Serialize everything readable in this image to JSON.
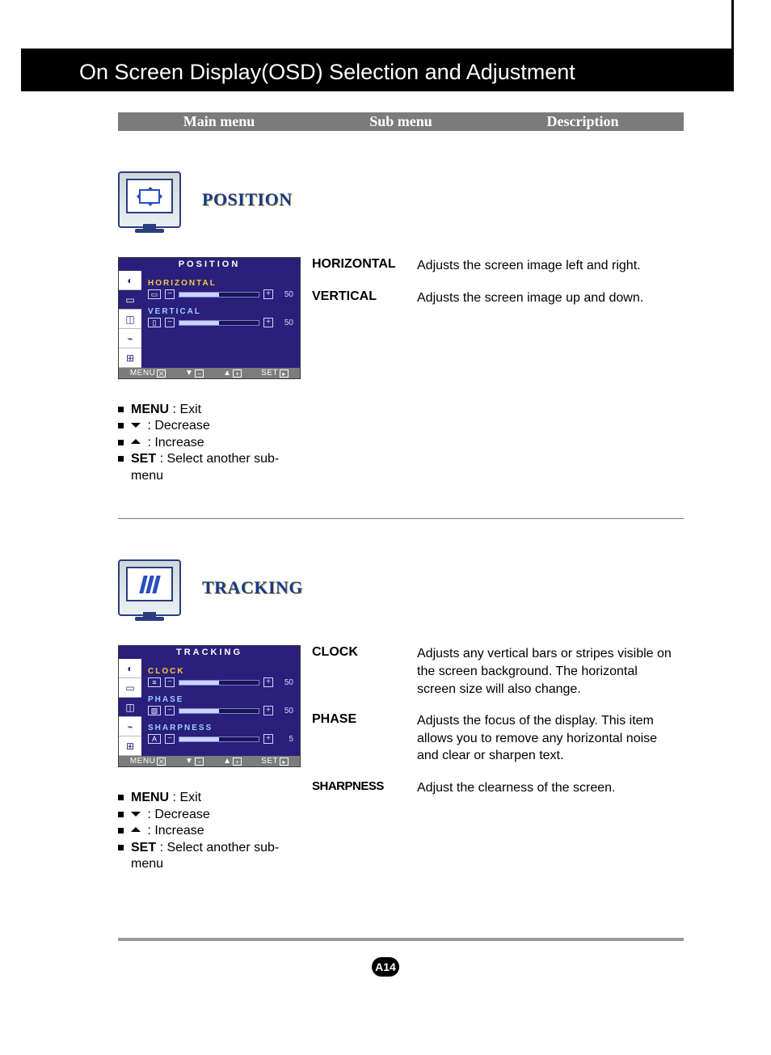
{
  "page_title": "On Screen Display(OSD) Selection and Adjustment",
  "columns": {
    "main": "Main menu",
    "sub": "Sub menu",
    "desc": "Description"
  },
  "sections": [
    {
      "id": "position",
      "title": "POSITION",
      "osd": {
        "title": "POSITION",
        "rows": [
          {
            "label": "HORIZONTAL",
            "value": "50",
            "selected": true
          },
          {
            "label": "VERTICAL",
            "value": "50",
            "selected": false
          }
        ],
        "footer": {
          "menu": "MENU",
          "down": "▼",
          "up": "▲",
          "set": "SET"
        }
      },
      "defs": [
        {
          "term": "HORIZONTAL",
          "desc": "Adjusts the screen image left and right."
        },
        {
          "term": "VERTICAL",
          "desc": "Adjusts the screen image up and down."
        }
      ],
      "bullets": [
        {
          "strong": "MENU",
          "rest": " : Exit"
        },
        {
          "glyph": "down",
          "rest": " : Decrease"
        },
        {
          "glyph": "up",
          "rest": " : Increase"
        },
        {
          "strong": "SET",
          "rest": " : Select another sub-menu"
        }
      ]
    },
    {
      "id": "tracking",
      "title": "TRACKING",
      "osd": {
        "title": "TRACKING",
        "rows": [
          {
            "label": "CLOCK",
            "value": "50",
            "selected": true
          },
          {
            "label": "PHASE",
            "value": "50",
            "selected": false
          },
          {
            "label": "SHARPNESS",
            "value": "5",
            "selected": false,
            "iconText": "A"
          }
        ],
        "footer": {
          "menu": "MENU",
          "down": "▼",
          "up": "▲",
          "set": "SET"
        }
      },
      "defs": [
        {
          "term": "CLOCK",
          "desc": "Adjusts any vertical bars or stripes visible on the screen background. The horizontal screen size will also change."
        },
        {
          "term": "PHASE",
          "desc": "Adjusts the focus of the display. This item allows you to remove any horizontal noise and clear or sharpen text."
        },
        {
          "term": "SHARPNESS",
          "desc": "Adjust the clearness of the screen.",
          "narrow": true
        }
      ],
      "bullets": [
        {
          "strong": "MENU",
          "rest": " : Exit"
        },
        {
          "glyph": "down",
          "rest": " : Decrease"
        },
        {
          "glyph": "up",
          "rest": " : Increase"
        },
        {
          "strong": "SET",
          "rest": " : Select another sub-menu"
        }
      ]
    }
  ],
  "page_number": "A14"
}
